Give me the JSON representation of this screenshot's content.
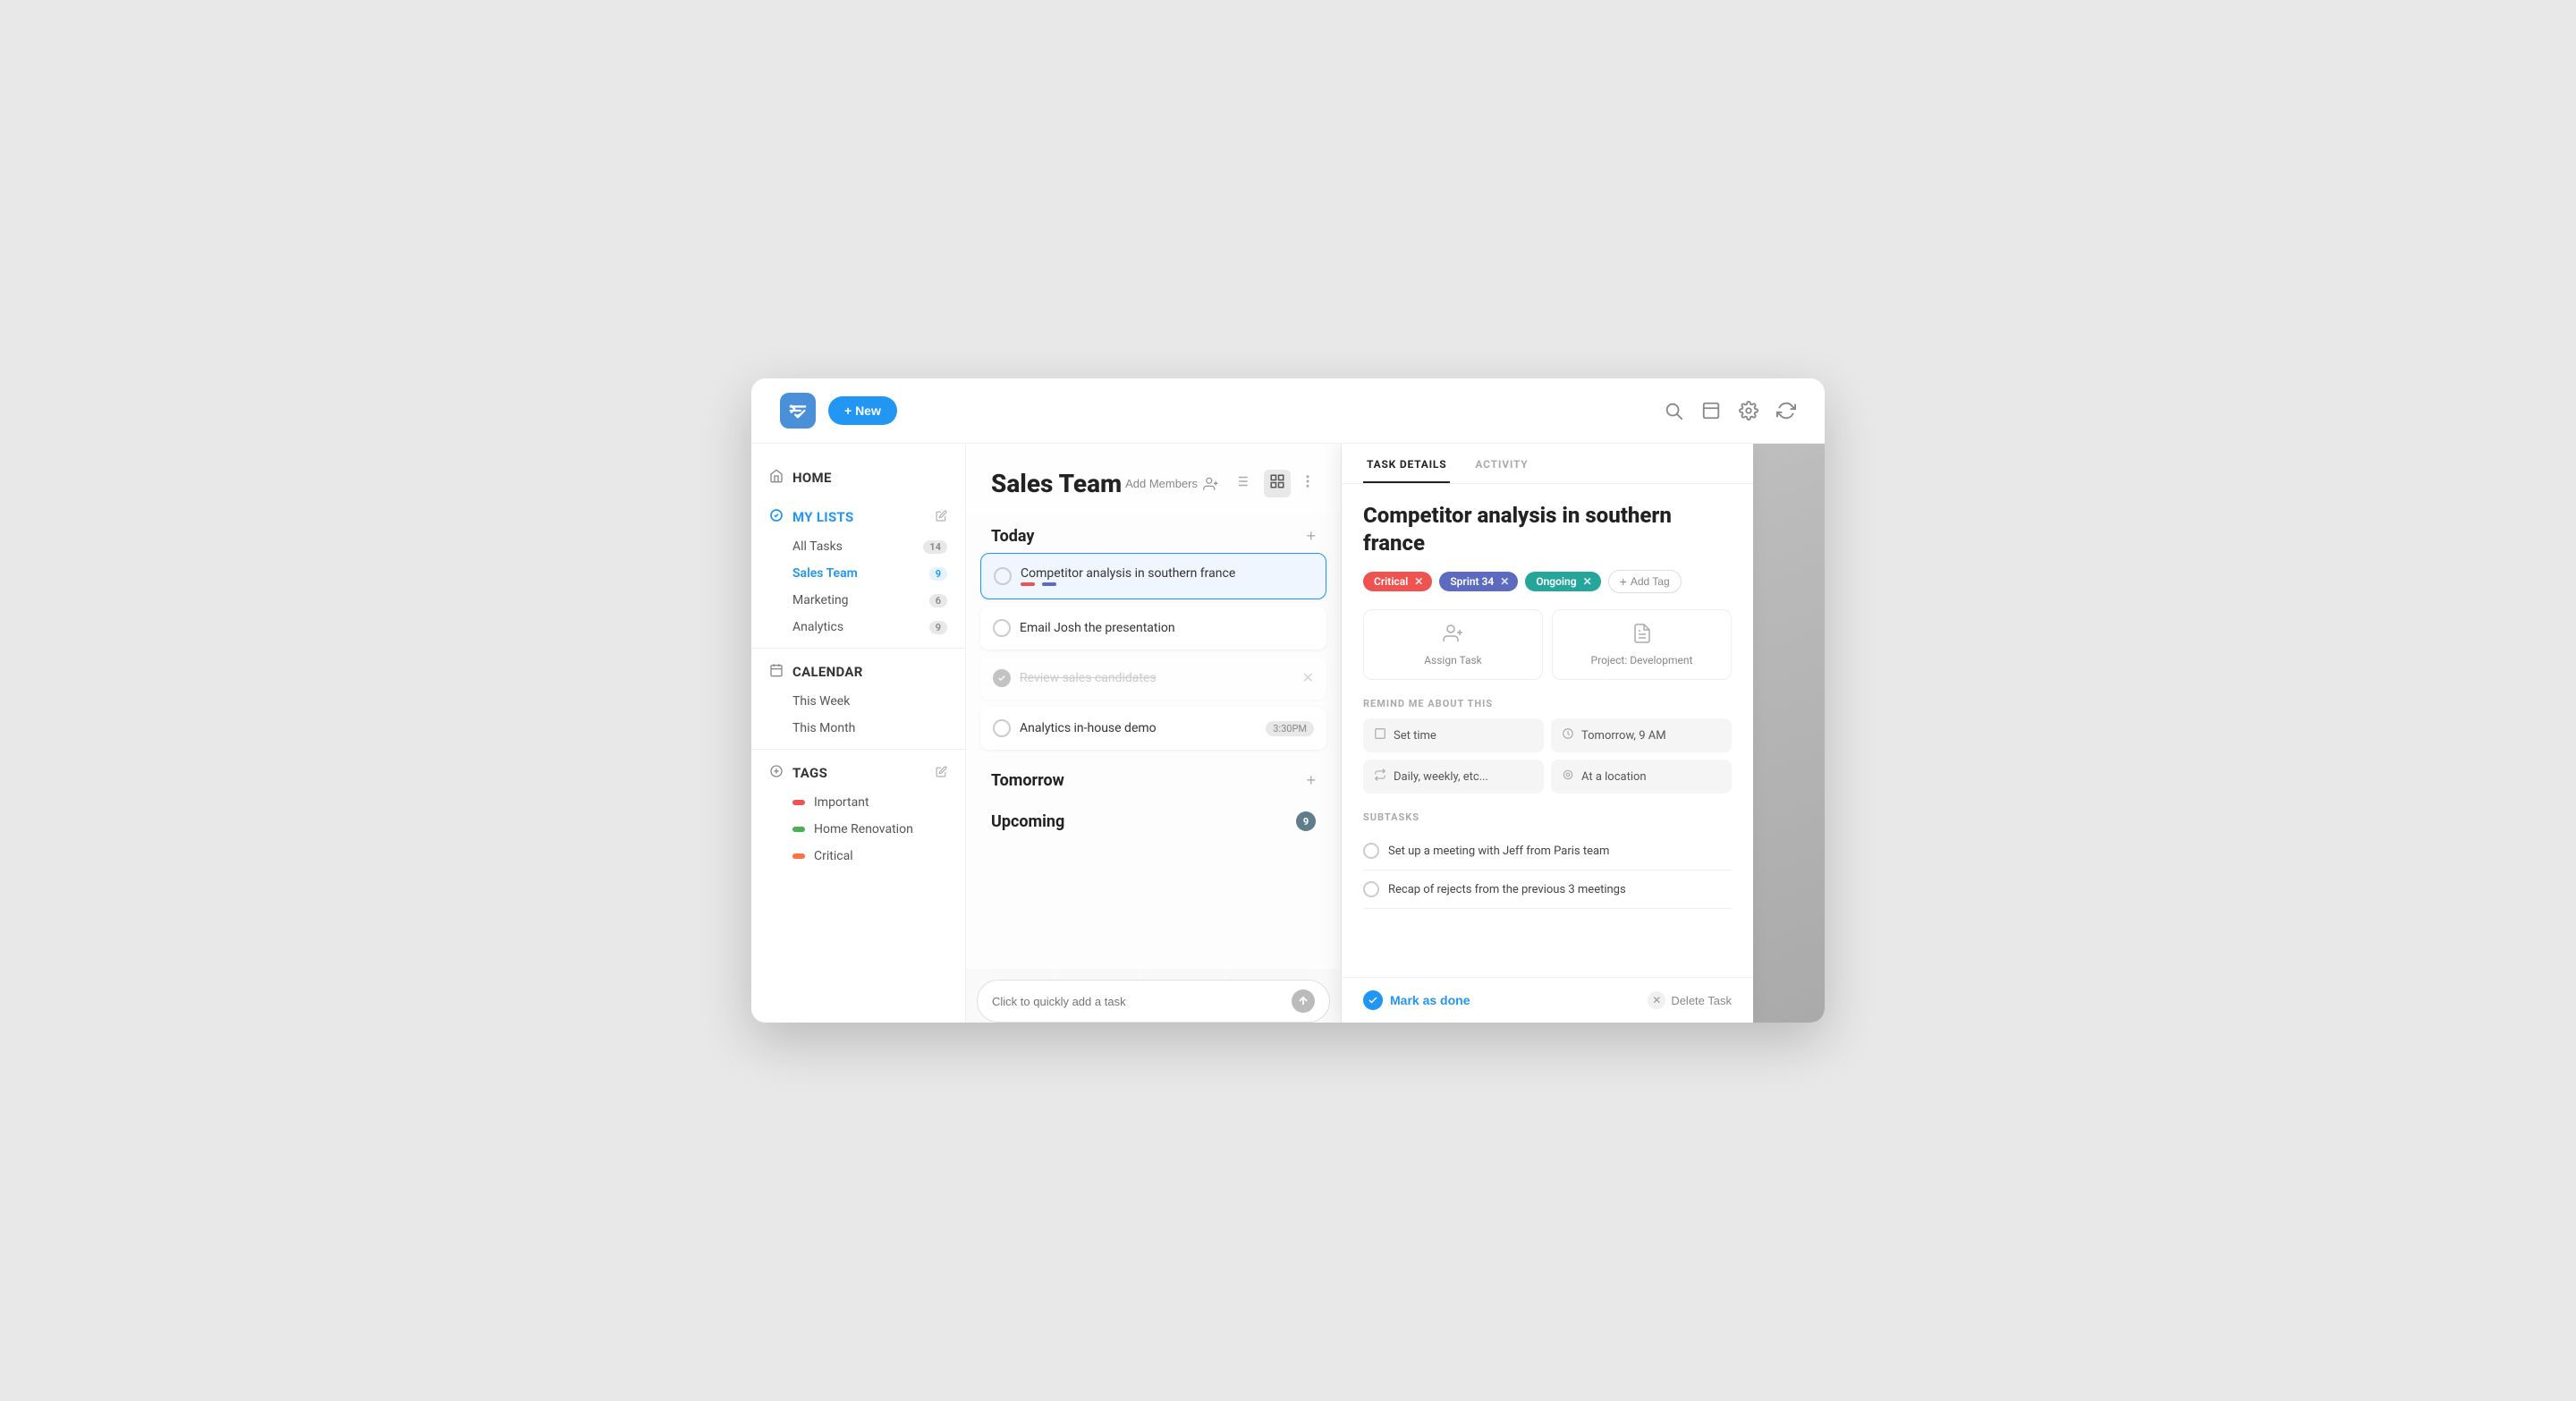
{
  "topbar": {
    "new_label": "+ New",
    "search_icon": "search",
    "window_icon": "window",
    "settings_icon": "settings",
    "sync_icon": "sync"
  },
  "sidebar": {
    "home_label": "HOME",
    "my_lists_label": "MY LISTS",
    "calendar_label": "CALENDAR",
    "tags_label": "TAGS",
    "items": [
      {
        "label": "All Tasks",
        "badge": "14",
        "active": false
      },
      {
        "label": "Sales Team",
        "badge": "9",
        "active": true
      },
      {
        "label": "Marketing",
        "badge": "6",
        "active": false
      },
      {
        "label": "Analytics",
        "badge": "9",
        "active": false
      }
    ],
    "calendar_items": [
      {
        "label": "This Week"
      },
      {
        "label": "This Month"
      }
    ],
    "tags": [
      {
        "label": "Important",
        "color": "#ef5350"
      },
      {
        "label": "Home Renovation",
        "color": "#4caf50"
      },
      {
        "label": "Critical",
        "color": "#ff7043"
      }
    ]
  },
  "task_panel": {
    "title": "Sales Team",
    "add_members_label": "Add Members",
    "today_label": "Today",
    "tomorrow_label": "Tomorrow",
    "upcoming_label": "Upcoming",
    "upcoming_badge": "9",
    "tasks_today": [
      {
        "text": "Competitor analysis in southern france",
        "completed": false,
        "selected": true,
        "tags": [
          "#ef5350",
          "#5c6bc0"
        ]
      },
      {
        "text": "Email Josh the presentation",
        "completed": false,
        "selected": false,
        "tags": []
      },
      {
        "text": "Review sales candidates",
        "completed": true,
        "selected": false,
        "tags": []
      },
      {
        "text": "Analytics in-house demo",
        "completed": false,
        "selected": false,
        "time": "3:30PM",
        "tags": []
      }
    ],
    "quick_add_placeholder": "Click to quickly add a task"
  },
  "detail_panel": {
    "tab_details": "TASK DETAILS",
    "tab_activity": "ACTIVITY",
    "task_title": "Competitor analysis in southern france",
    "tags": [
      {
        "label": "Critical",
        "type": "critical"
      },
      {
        "label": "Sprint 34",
        "type": "sprint"
      },
      {
        "label": "Ongoing",
        "type": "ongoing"
      }
    ],
    "add_tag_label": "Add Tag",
    "assign_task_label": "Assign Task",
    "project_label": "Project: Development",
    "remind_section_label": "REMIND ME ABOUT THIS",
    "remind_items": [
      {
        "icon": "clock",
        "text": "Set time"
      },
      {
        "icon": "clock-filled",
        "text": "Tomorrow, 9 AM"
      },
      {
        "icon": "repeat",
        "text": "Daily, weekly, etc..."
      },
      {
        "icon": "location",
        "text": "At a location"
      }
    ],
    "subtasks_label": "SUBTASKS",
    "subtasks": [
      {
        "text": "Set up a meeting with Jeff from Paris team",
        "done": false
      },
      {
        "text": "Recap of rejects from the previous 3 meetings",
        "done": false
      }
    ],
    "mark_done_label": "Mark as done",
    "delete_task_label": "Delete Task"
  }
}
